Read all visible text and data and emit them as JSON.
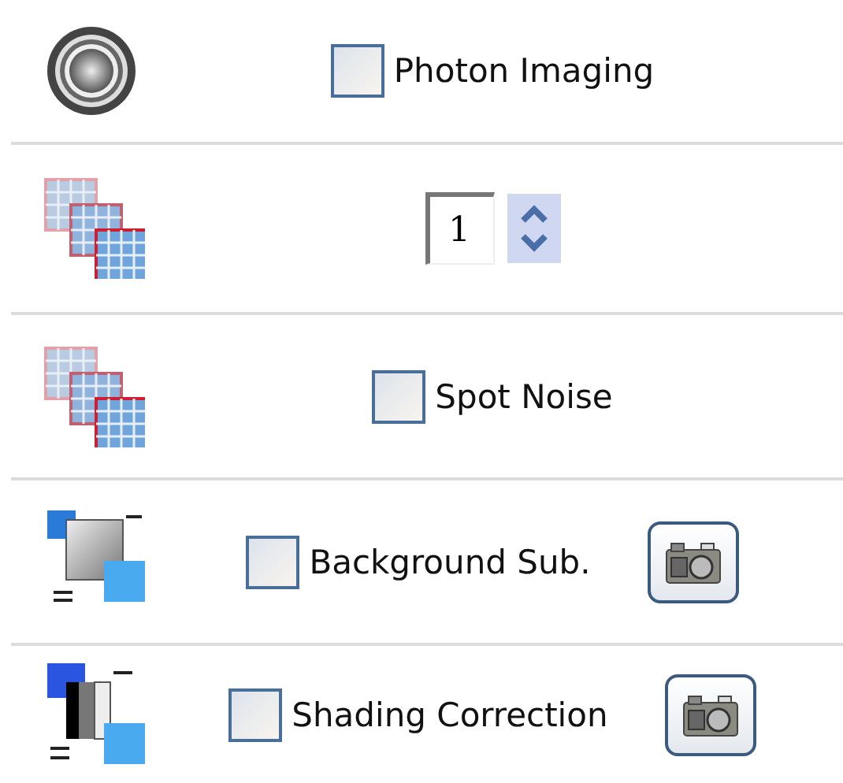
{
  "rows": [
    {
      "kind": "checkbox",
      "label": "Photon Imaging",
      "checked": false
    },
    {
      "kind": "spinner",
      "value": "1"
    },
    {
      "kind": "checkbox",
      "label": "Spot Noise",
      "checked": false
    },
    {
      "kind": "checkbox_camera",
      "label": "Background Sub.",
      "checked": false
    },
    {
      "kind": "checkbox_camera",
      "label": "Shading Correction",
      "checked": false
    }
  ]
}
